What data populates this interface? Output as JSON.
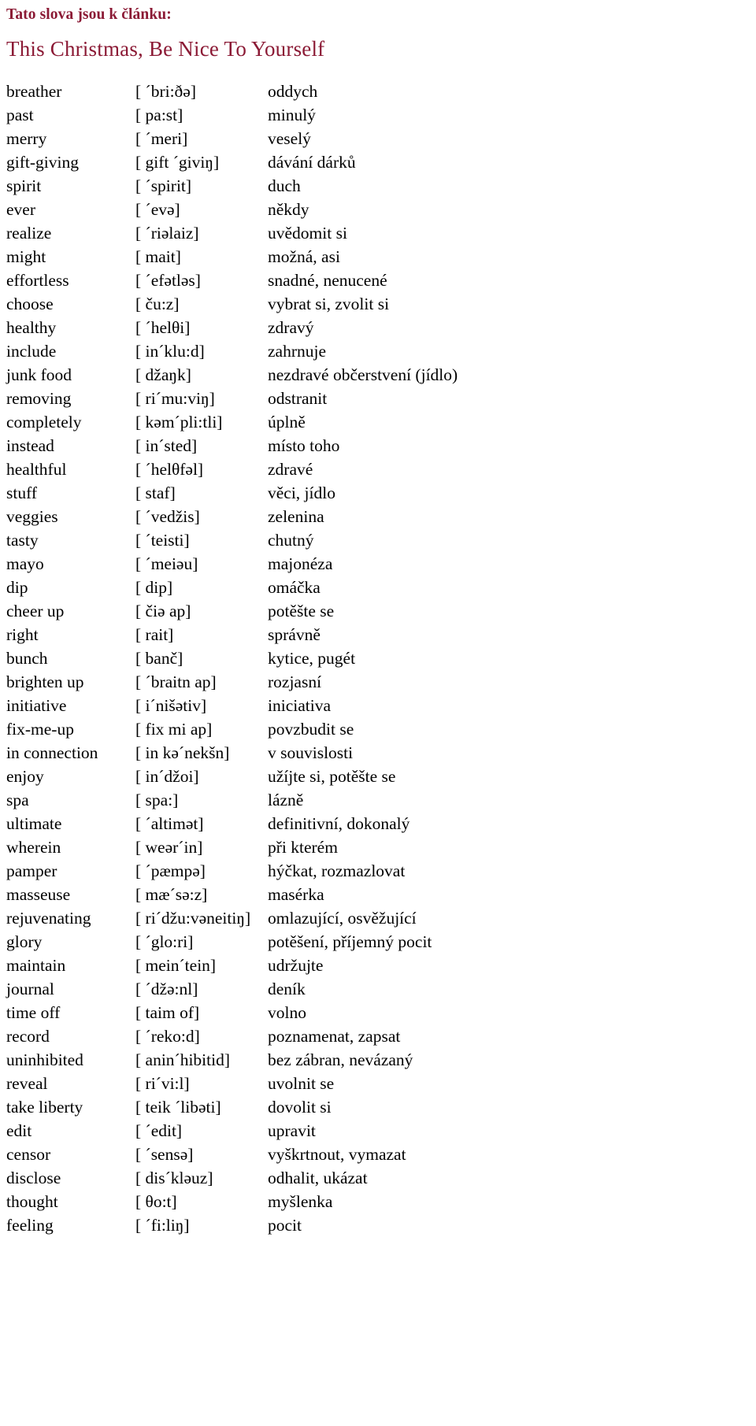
{
  "header": {
    "intro_line": "Tato slova jsou k článku:",
    "article_title": "This Christmas, Be Nice To Yourself",
    "heading_color": "#8B1A35"
  },
  "vocabulary": {
    "columns": [
      "term",
      "phonetic",
      "meaning"
    ],
    "rows": [
      {
        "term": "breather",
        "phonetic": "[ ´bri:ðə]",
        "meaning": "oddych"
      },
      {
        "term": "past",
        "phonetic": "[ pa:st]",
        "meaning": "minulý"
      },
      {
        "term": "merry",
        "phonetic": "[ ´meri]",
        "meaning": "veselý"
      },
      {
        "term": "gift-giving",
        "phonetic": "[ gift ´giviŋ]",
        "meaning": "dávání dárků"
      },
      {
        "term": "spirit",
        "phonetic": "[ ´spirit]",
        "meaning": "duch"
      },
      {
        "term": "ever",
        "phonetic": "[ ´evə]",
        "meaning": "někdy"
      },
      {
        "term": "realize",
        "phonetic": "[ ´riəlaiz]",
        "meaning": "uvědomit si"
      },
      {
        "term": "might",
        "phonetic": "[ mait]",
        "meaning": "možná, asi"
      },
      {
        "term": "effortless",
        "phonetic": "[ ´efətləs]",
        "meaning": "snadné, nenucené"
      },
      {
        "term": "choose",
        "phonetic": "[ ču:z]",
        "meaning": "vybrat si, zvolit si"
      },
      {
        "term": "healthy",
        "phonetic": "[ ´helθi]",
        "meaning": "zdravý"
      },
      {
        "term": "include",
        "phonetic": "[ in´klu:d]",
        "meaning": "zahrnuje"
      },
      {
        "term": "junk food",
        "phonetic": "[ džaŋk]",
        "meaning": "nezdravé občerstvení (jídlo)"
      },
      {
        "term": "removing",
        "phonetic": "[ ri´mu:viŋ]",
        "meaning": "odstranit"
      },
      {
        "term": "completely",
        "phonetic": "[ kəm´pli:tli]",
        "meaning": "úplně"
      },
      {
        "term": "instead",
        "phonetic": "[ in´sted]",
        "meaning": "místo toho"
      },
      {
        "term": "healthful",
        "phonetic": "[ ´helθfəl]",
        "meaning": "zdravé"
      },
      {
        "term": "stuff",
        "phonetic": "[ staf]",
        "meaning": "věci, jídlo"
      },
      {
        "term": "veggies",
        "phonetic": "[ ´vedžis]",
        "meaning": "zelenina"
      },
      {
        "term": "tasty",
        "phonetic": "[ ´teisti]",
        "meaning": "chutný"
      },
      {
        "term": "mayo",
        "phonetic": "[ ´meiəu]",
        "meaning": "majonéza"
      },
      {
        "term": "dip",
        "phonetic": "[ dip]",
        "meaning": "omáčka"
      },
      {
        "term": "cheer up",
        "phonetic": "[ čiə ap]",
        "meaning": "potěšte se"
      },
      {
        "term": "right",
        "phonetic": "[ rait]",
        "meaning": "správně"
      },
      {
        "term": "bunch",
        "phonetic": "[ banč]",
        "meaning": "kytice, pugét"
      },
      {
        "term": "brighten up",
        "phonetic": "[ ´braitn ap]",
        "meaning": "rozjasní"
      },
      {
        "term": "initiative",
        "phonetic": "[ i´nišətiv]",
        "meaning": "iniciativa"
      },
      {
        "term": "fix-me-up",
        "phonetic": "[ fix mi ap]",
        "meaning": "povzbudit se"
      },
      {
        "term": "in connection",
        "phonetic": "[ in kə´nekšn]",
        "meaning": "v souvislosti"
      },
      {
        "term": "enjoy",
        "phonetic": "[ in´džoi]",
        "meaning": "užíjte si, potěšte se"
      },
      {
        "term": "spa",
        "phonetic": "[ spa:]",
        "meaning": "lázně"
      },
      {
        "term": "ultimate",
        "phonetic": "[ ´altimət]",
        "meaning": "definitivní, dokonalý"
      },
      {
        "term": "wherein",
        "phonetic": "[ weər´in]",
        "meaning": "při kterém"
      },
      {
        "term": "pamper",
        "phonetic": "[ ´pæmpə]",
        "meaning": "hýčkat, rozmazlovat"
      },
      {
        "term": "masseuse",
        "phonetic": "[ mæ´sə:z]",
        "meaning": "masérka"
      },
      {
        "term": "rejuvenating",
        "phonetic": "[ ri´džu:vəneitiŋ]",
        "meaning": "omlazující, osvěžující"
      },
      {
        "term": "glory",
        "phonetic": "[ ´glo:ri]",
        "meaning": "potěšení, příjemný pocit"
      },
      {
        "term": "maintain",
        "phonetic": "[ mein´tein]",
        "meaning": "udržujte"
      },
      {
        "term": "journal",
        "phonetic": "[ ´džə:nl]",
        "meaning": "deník"
      },
      {
        "term": "time off",
        "phonetic": "[ taim of]",
        "meaning": "volno"
      },
      {
        "term": "record",
        "phonetic": "[ ´reko:d]",
        "meaning": "poznamenat, zapsat"
      },
      {
        "term": "uninhibited",
        "phonetic": "[ anin´hibitid]",
        "meaning": "bez zábran, nevázaný"
      },
      {
        "term": "reveal",
        "phonetic": "[ ri´vi:l]",
        "meaning": "uvolnit se"
      },
      {
        "term": "take liberty",
        "phonetic": "[ teik ´libəti]",
        "meaning": "dovolit si"
      },
      {
        "term": "edit",
        "phonetic": "[ ´edit]",
        "meaning": "upravit"
      },
      {
        "term": "censor",
        "phonetic": "[ ´sensə]",
        "meaning": "vyškrtnout, vymazat"
      },
      {
        "term": "disclose",
        "phonetic": "[ dis´kləuz]",
        "meaning": "odhalit, ukázat"
      },
      {
        "term": "thought",
        "phonetic": "[ θo:t]",
        "meaning": "myšlenka"
      },
      {
        "term": "feeling",
        "phonetic": "[ ´fi:liŋ]",
        "meaning": "pocit"
      }
    ]
  }
}
